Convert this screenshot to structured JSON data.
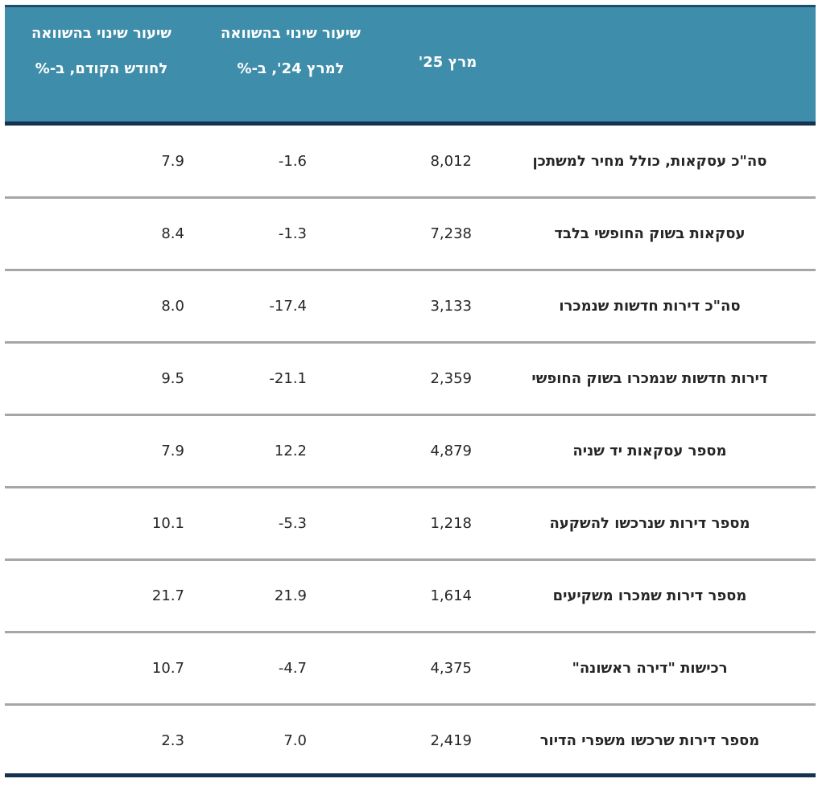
{
  "table": {
    "headers": {
      "prev_month_line1": "שיעור שינוי בהשוואה",
      "prev_month_line2": "לחודש הקודם, ב-%",
      "yoy_line1": "שיעור שינוי בהשוואה",
      "yoy_line2": "למרץ 24', ב-%",
      "value": "מרץ 25'"
    },
    "rows": [
      {
        "label": "סה\"כ עסקאות, כולל מחיר למשתכן",
        "value": "8,012",
        "yoy": "-1.6",
        "prev": "7.9"
      },
      {
        "label": "עסקאות בשוק החופשי בלבד",
        "value": "7,238",
        "yoy": "-1.3",
        "prev": "8.4"
      },
      {
        "label": "סה\"כ דירות חדשות שנמכרו",
        "value": "3,133",
        "yoy": "-17.4",
        "prev": "8.0"
      },
      {
        "label": "דירות חדשות שנמכרו בשוק החופשי",
        "value": "2,359",
        "yoy": "-21.1",
        "prev": "9.5"
      },
      {
        "label": "מספר עסקאות יד שניה",
        "value": "4,879",
        "yoy": "12.2",
        "prev": "7.9"
      },
      {
        "label": "מספר דירות שנרכשו להשקעה",
        "value": "1,218",
        "yoy": "-5.3",
        "prev": "10.1"
      },
      {
        "label": "מספר דירות שמכרו משקיעים",
        "value": "1,614",
        "yoy": "21.9",
        "prev": "21.7"
      },
      {
        "label": "רכישות \"דירה ראשונה\"",
        "value": "4,375",
        "yoy": "-4.7",
        "prev": "10.7"
      },
      {
        "label": "מספר דירות שרכשו משפרי הדיור",
        "value": "2,419",
        "yoy": "7.0",
        "prev": "2.3"
      }
    ]
  }
}
